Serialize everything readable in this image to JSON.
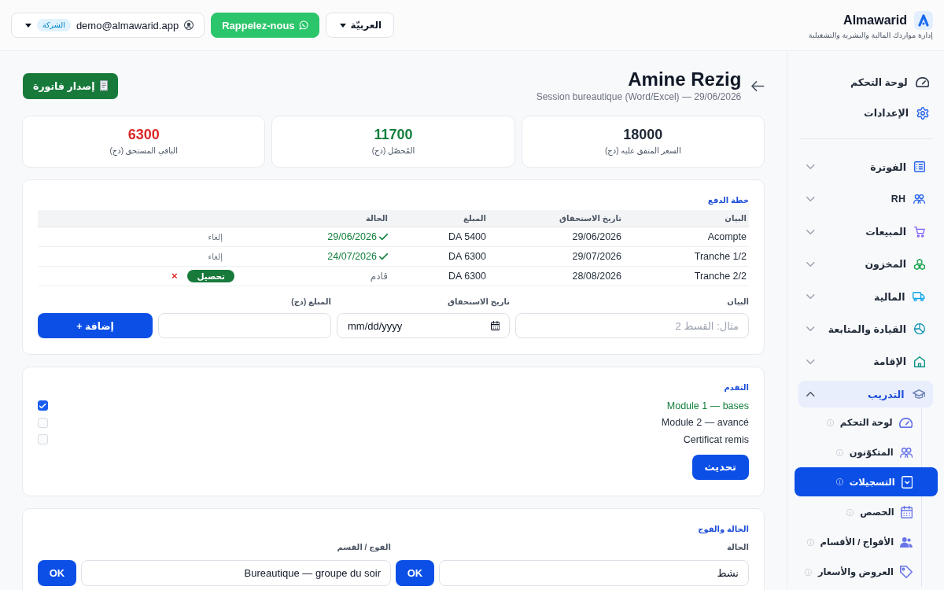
{
  "header": {
    "brand": {
      "name": "Almawarid",
      "tagline": "إدارة مواردك المالية والبشرية والتشغيلية"
    },
    "language": {
      "label": "العربيّة"
    },
    "callback_button": {
      "label": "Rappelez-nous"
    },
    "account": {
      "email": "demo@almawarid.app",
      "badge": "الشركة"
    }
  },
  "sidebar": {
    "links": [
      {
        "label": "لوحة التحكم",
        "selected": false
      },
      {
        "label": "الإعدادات",
        "selected": false
      }
    ],
    "groups": [
      {
        "label": "الفوترة",
        "expanded": false
      },
      {
        "label": "RH",
        "expanded": false
      },
      {
        "label": "المبيعات",
        "expanded": false
      },
      {
        "label": "المخزون",
        "expanded": false
      },
      {
        "label": "المالية",
        "expanded": false
      },
      {
        "label": "القيادة والمتابعة",
        "expanded": false
      },
      {
        "label": "الإقامة",
        "expanded": false
      },
      {
        "label": "التدريب",
        "expanded": true,
        "children": [
          {
            "label": "لوحة التحكم",
            "selected": false
          },
          {
            "label": "المتكوّنون",
            "selected": false
          },
          {
            "label": "التسجيلات",
            "selected": true
          },
          {
            "label": "الحصص",
            "selected": false
          },
          {
            "label": "الأفواج / الأقسام",
            "selected": false
          },
          {
            "label": "العروض والأسعار",
            "selected": false
          }
        ]
      }
    ]
  },
  "page": {
    "title": "Amine Rezig",
    "subtitle": "Session bureautique (Word/Excel) — 29/06/2026",
    "invoice_button": "إصدار فاتورة"
  },
  "stats": [
    {
      "value": "18000",
      "label": "السعر المتفق عليه (دج)",
      "color": "#1f2937"
    },
    {
      "value": "11700",
      "label": "المُحصّل (دج)",
      "color": "#15803d"
    },
    {
      "value": "6300",
      "label": "الباقي المستحق (دج)",
      "color": "#dc2626"
    }
  ],
  "payment_plan": {
    "title": "خطة الدفع",
    "columns": [
      "البيان",
      "تاريخ الاستحقاق",
      "المبلغ",
      "الحالة"
    ],
    "rows": [
      {
        "label": "Acompte",
        "due_date": "29/06/2026",
        "amount": "DA 5400",
        "status": {
          "paid": true,
          "text": "29/06/2026"
        },
        "actions": [
          {
            "kind": "link",
            "label": "إلغاء"
          }
        ]
      },
      {
        "label": "Tranche 1/2",
        "due_date": "29/07/2026",
        "amount": "DA 6300",
        "status": {
          "paid": true,
          "text": "24/07/2026"
        },
        "actions": [
          {
            "kind": "link",
            "label": "إلغاء"
          }
        ]
      },
      {
        "label": "Tranche 2/2",
        "due_date": "28/08/2026",
        "amount": "DA 6300",
        "status": {
          "paid": false,
          "text": "قادم"
        },
        "actions": [
          {
            "kind": "button",
            "label": "تحصيل"
          },
          {
            "kind": "remove",
            "label": "×"
          }
        ]
      }
    ],
    "form": {
      "fields": [
        {
          "kind": "text",
          "label": "البيان",
          "placeholder": "مثال: القسط 2"
        },
        {
          "kind": "date",
          "label": "تاريخ الاستحقاق",
          "placeholder": "mm/dd/yyyy"
        },
        {
          "kind": "number",
          "label": "المبلغ (دج)"
        }
      ],
      "add_button": "+ إضافة"
    }
  },
  "progress": {
    "title": "التقدم",
    "items": [
      {
        "label": "Module 1 — bases",
        "checked": true
      },
      {
        "label": "Module 2 — avancé",
        "checked": false
      },
      {
        "label": "Certificat remis",
        "checked": false
      }
    ],
    "update_button": "تحديث"
  },
  "status": {
    "title": "الحالة والفوج",
    "fields": [
      {
        "label": "الحالة",
        "value": "نشط",
        "button": "OK"
      },
      {
        "label": "الفوج / القسم",
        "value": "Bureautique — groupe du soir",
        "button": "OK"
      }
    ]
  }
}
